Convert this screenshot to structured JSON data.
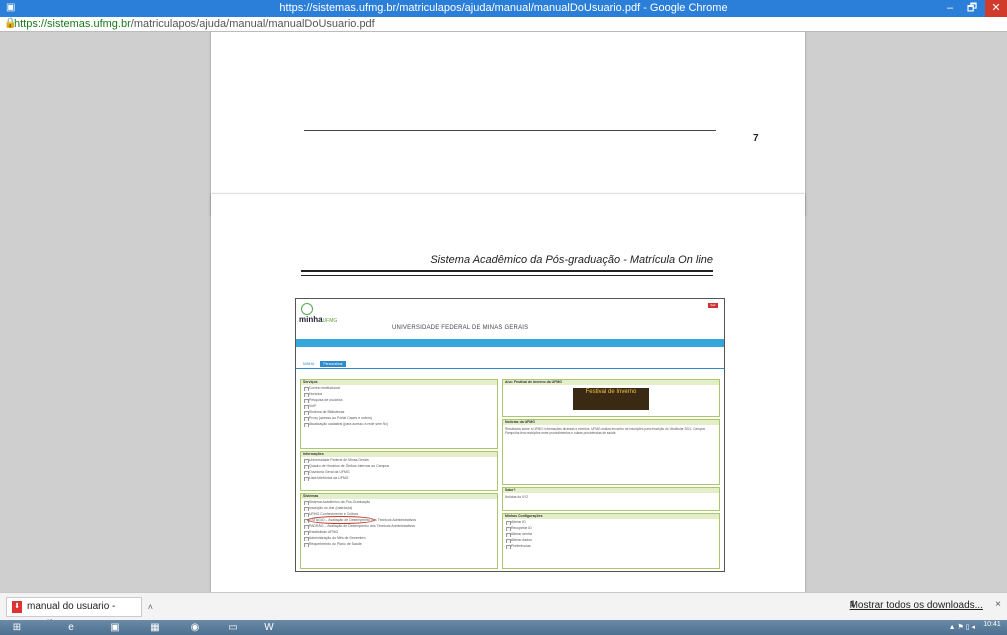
{
  "window": {
    "title": "https://sistemas.ufmg.br/matriculapos/ajuda/manual/manualDoUsuario.pdf - Google Chrome",
    "minimize": "–",
    "maximize": "🗗",
    "close": "✕"
  },
  "address": {
    "host": "https://sistemas.ufmg.br",
    "path": "/matriculapos/ajuda/manual/manualDoUsuario.pdf"
  },
  "pdf": {
    "page1_number": "7",
    "page2_header": "Sistema Acadêmico da Pós-graduação - Matrícula On line"
  },
  "embedded": {
    "logo_main": "minha",
    "logo_sub": "UFMG",
    "university": "UNIVERSIDADE FEDERAL DE MINAS GERAIS",
    "sair": "Sair",
    "tabs": [
      "MINHA",
      "Personalizar"
    ],
    "panels": {
      "servicos": {
        "title": "Serviços",
        "items": [
          "Correio institucional",
          "Horários",
          "Pesquisa de usuários",
          "VoIP",
          "Sistema de Bibliotecas",
          "Proxy (acesso ao Portal Capes e outros)",
          "Atualização cadastral (para acesso à rede sem fio)"
        ]
      },
      "informacoes": {
        "title": "Informações",
        "items": [
          "Universidade Federal de Minas Gerais",
          "Quadro de Horários de Ônibus Internos ao Campus",
          "Ouvidoria Geral da UFMG",
          "Lista telefônica da UFMG"
        ]
      },
      "sistemas": {
        "title": "Sistemas",
        "items": [
          "Sistema Acadêmico da Pós-Graduação",
          "Inscrição on-line (matrícula)",
          "UFMG Conhecimento e Cultura",
          "ESTÁGIO – Avaliação de Desempenho dos Técnicos Administrativos",
          "PADRÃO – Avaliação de Desempenho dos Técnicos Administrativos",
          "Estatísticas UFMG",
          "Administração do Mês de Dezembro",
          "Requerimento do Plano de Saúde"
        ]
      },
      "festival": {
        "title": "Ano: Festival de Inverno da UFMG",
        "banner": "Festival de Inverno"
      },
      "noticias": {
        "title": "Notícias da UFMG",
        "text": "Resultados sobre a UFMG: informações diversas e eventos. UFMG realiza encontro de inscrições para inscrição do Vestibular 2011. Campus Pampulha terá restrições entre procedimentos e outras providências de saúde."
      },
      "sabe": {
        "title": "Sabe?",
        "text": "Notícias da XYZ"
      },
      "config": {
        "title": "Minhas Configurações",
        "items": [
          "Alterar ID",
          "Recuperar ID",
          "Alterar senha",
          "Alterar dados",
          "Preferências"
        ]
      }
    }
  },
  "downloads": {
    "file": "manual do usuario - ....pdf",
    "show_all": "Mostrar todos os downloads...",
    "close": "×"
  },
  "taskbar": {
    "time": "10:41"
  }
}
